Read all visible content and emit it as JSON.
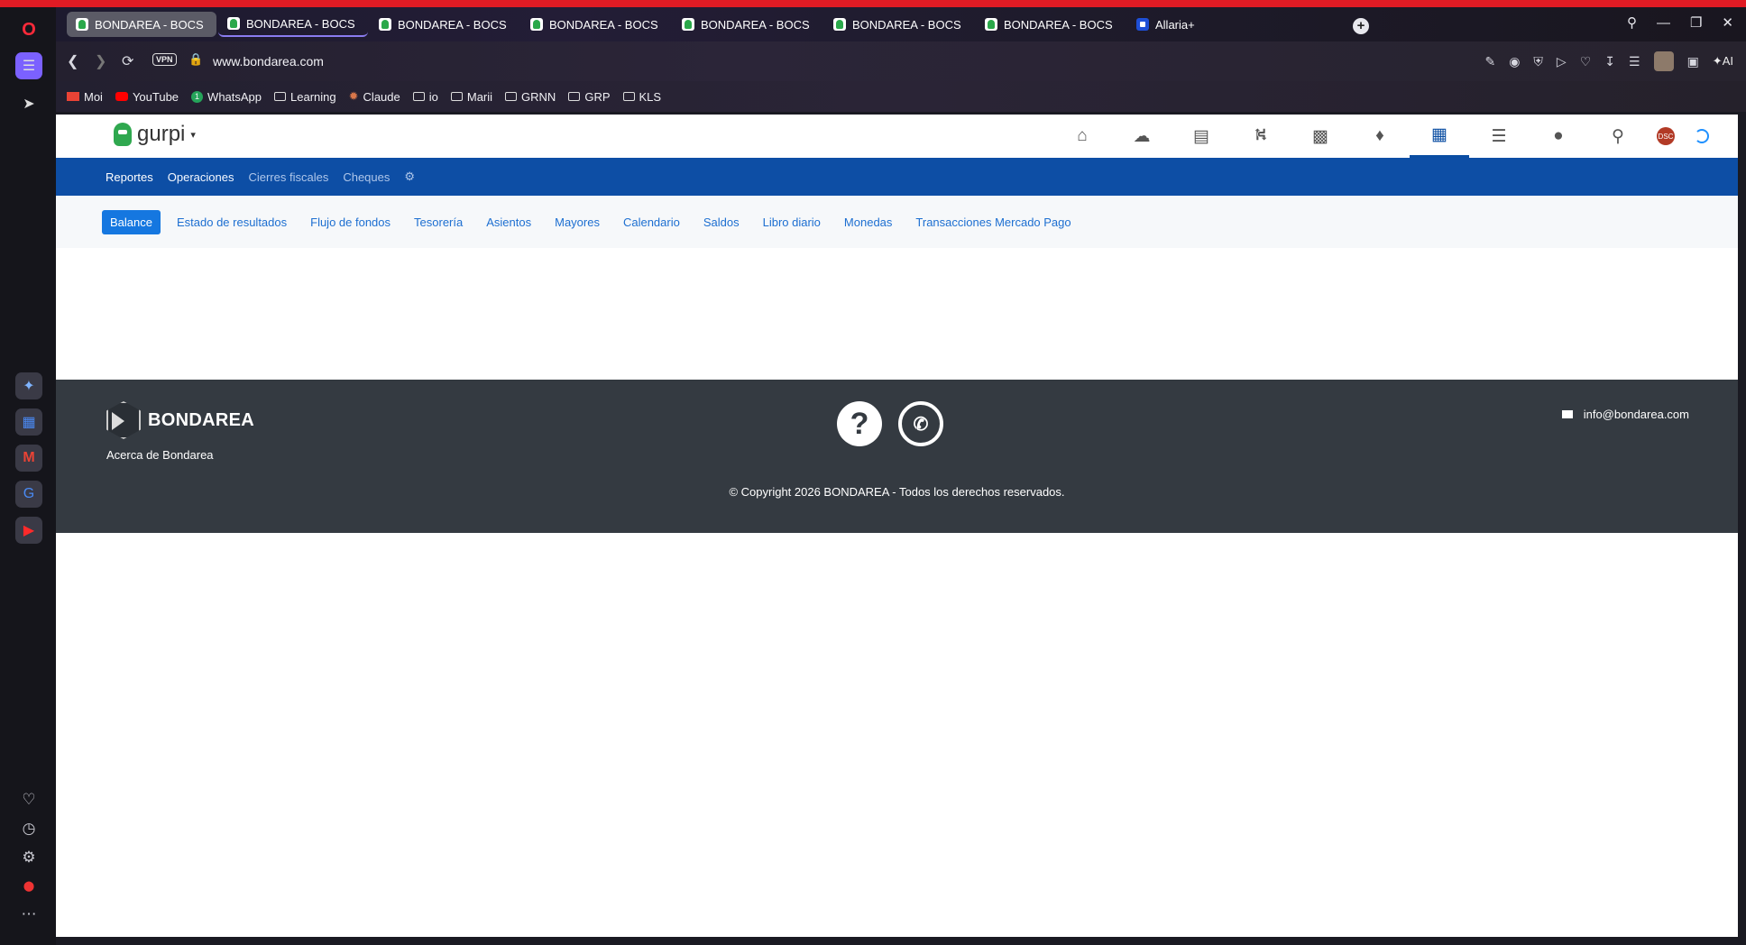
{
  "browser": {
    "tabs": [
      {
        "title": "BONDAREA - BOCS"
      },
      {
        "title": "BONDAREA - BOCS"
      },
      {
        "title": "BONDAREA - BOCS"
      },
      {
        "title": "BONDAREA - BOCS"
      },
      {
        "title": "BONDAREA - BOCS"
      },
      {
        "title": "BONDAREA - BOCS"
      },
      {
        "title": "BONDAREA - BOCS"
      },
      {
        "title": "Allaria+"
      }
    ],
    "vpn_label": "VPN",
    "url": "www.bondarea.com",
    "ai_label": "AI",
    "bookmarks": [
      {
        "label": "Moi",
        "icon": "gmail-icon"
      },
      {
        "label": "YouTube",
        "icon": "youtube-icon"
      },
      {
        "label": "WhatsApp",
        "icon": "whatsapp-icon"
      },
      {
        "label": "Learning",
        "icon": "folder-icon"
      },
      {
        "label": "Claude",
        "icon": "claude-icon"
      },
      {
        "label": "io",
        "icon": "folder-icon"
      },
      {
        "label": "Marii",
        "icon": "folder-icon"
      },
      {
        "label": "GRNN",
        "icon": "folder-icon"
      },
      {
        "label": "GRP",
        "icon": "folder-icon"
      },
      {
        "label": "KLS",
        "icon": "folder-icon"
      }
    ],
    "whatsapp_badge": "1"
  },
  "app": {
    "logo_text": "gurpi",
    "user_badge": "DSC",
    "top_nav_icons": [
      "home-icon",
      "chat-icon",
      "chart-icon",
      "cart-icon",
      "id-card-icon",
      "tag-icon",
      "calculator-icon",
      "tasks-icon",
      "user-icon",
      "search-icon"
    ],
    "main_nav": {
      "items": [
        "Reportes",
        "Operaciones",
        "Cierres fiscales",
        "Cheques"
      ]
    },
    "sub_nav": {
      "items": [
        "Balance",
        "Estado de resultados",
        "Flujo de fondos",
        "Tesorería",
        "Asientos",
        "Mayores",
        "Calendario",
        "Saldos",
        "Libro diario",
        "Monedas",
        "Transacciones Mercado Pago"
      ]
    },
    "footer": {
      "brand": "BONDAREA",
      "about": "Acerca de Bondarea",
      "email": "info@bondarea.com",
      "copyright": "© Copyright 2026 BONDAREA - Todos los derechos reservados."
    }
  },
  "colors": {
    "primary_blue": "#0d4ea5",
    "link_blue": "#1d6fd1",
    "footer_bg": "#343a41",
    "opera_red": "#e01b24"
  }
}
